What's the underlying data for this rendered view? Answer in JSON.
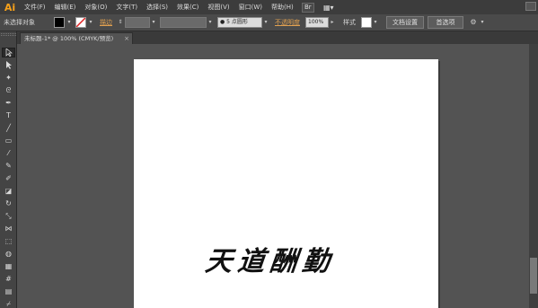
{
  "app": {
    "logo": "Ai"
  },
  "menu": {
    "items": [
      "文件(F)",
      "编辑(E)",
      "对象(O)",
      "文字(T)",
      "选择(S)",
      "效果(C)",
      "视图(V)",
      "窗口(W)",
      "帮助(H)"
    ]
  },
  "menu_icons": {
    "bridge": "Br",
    "arrange": "▦▾"
  },
  "control": {
    "no_selection": "未选择对象",
    "stroke_label": "描边",
    "brush_value": "● 5 点圆形",
    "opacity_label": "不透明度",
    "opacity_value": "100%",
    "style_label": "样式",
    "doc_setup": "文档设置",
    "preferences": "首选项"
  },
  "tab": {
    "title": "未标题-1* @ 100% (CMYK/预览)",
    "close": "×"
  },
  "artwork": {
    "text": "天道酬勤"
  },
  "colors": {
    "accent": "#f7a11a",
    "workspace": "#535353",
    "panel": "#4a4a4a"
  }
}
